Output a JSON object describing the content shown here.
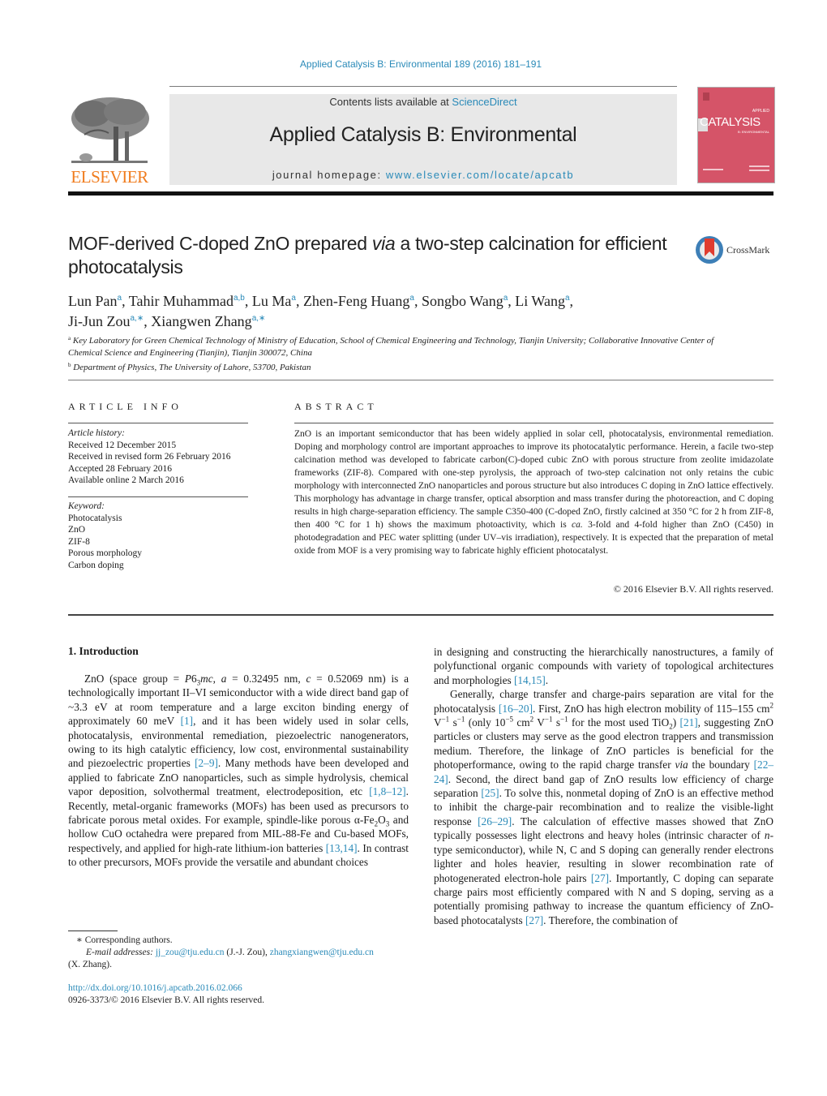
{
  "header": {
    "journal_ref": "Applied Catalysis B: Environmental 189 (2016) 181–191",
    "contents_prefix": "Contents lists available at ",
    "contents_link": "ScienceDirect",
    "journal_title": "Applied Catalysis B: Environmental",
    "homepage_prefix": "journal homepage: ",
    "homepage_link": "www.elsevier.com/locate/apcatb",
    "publisher_logo_text": "ELSEVIER",
    "cover": {
      "title": "CATALYSIS",
      "top_label": "APPLIED",
      "sub_label": "B: ENVIRONMENTAL",
      "color": "#d55468"
    }
  },
  "article": {
    "title_part1": "MOF-derived C-doped ZnO prepared ",
    "title_italic": "via",
    "title_part2": " a two-step calcination for efficient photocatalysis",
    "crossmark_label": "CrossMark",
    "authors": [
      {
        "name": "Lun Pan",
        "aff": "a"
      },
      {
        "name": "Tahir Muhammad",
        "aff": "a,b"
      },
      {
        "name": "Lu Ma",
        "aff": "a"
      },
      {
        "name": "Zhen-Feng Huang",
        "aff": "a"
      },
      {
        "name": "Songbo Wang",
        "aff": "a"
      },
      {
        "name": "Li Wang",
        "aff": "a"
      },
      {
        "name": "Ji-Jun Zou",
        "aff": "a,∗"
      },
      {
        "name": "Xiangwen Zhang",
        "aff": "a,∗"
      }
    ],
    "affiliations": [
      {
        "key": "a",
        "text": "Key Laboratory for Green Chemical Technology of Ministry of Education, School of Chemical Engineering and Technology, Tianjin University; Collaborative Innovative Center of Chemical Science and Engineering (Tianjin), Tianjin 300072, China"
      },
      {
        "key": "b",
        "text": "Department of Physics, The University of Lahore, 53700, Pakistan"
      }
    ]
  },
  "article_info": {
    "heading": "ARTICLE INFO",
    "history_label": "Article history:",
    "history": [
      "Received 12 December 2015",
      "Received in revised form 26 February 2016",
      "Accepted 28 February 2016",
      "Available online 2 March 2016"
    ],
    "keywords_label": "Keyword:",
    "keywords": [
      "Photocatalysis",
      "ZnO",
      "ZIF-8",
      "Porous morphology",
      "Carbon doping"
    ]
  },
  "abstract": {
    "heading": "ABSTRACT",
    "text_part1": "ZnO is an important semiconductor that has been widely applied in solar cell, photocatalysis, environmental remediation. Doping and morphology control are important approaches to improve its photocatalytic performance. Herein, a facile two-step calcination method was developed to fabricate carbon(C)-doped cubic ZnO with porous structure from zeolite imidazolate frameworks (ZIF-8). Compared with one-step pyrolysis, the approach of two-step calcination not only retains the cubic morphology with interconnected ZnO nanoparticles and porous structure but also introduces C doping in ZnO lattice effectively. This morphology has advantage in charge transfer, optical absorption and mass transfer during the photoreaction, and C doping results in high charge-separation efficiency. The sample C350-400 (C-doped ZnO, firstly calcined at 350 °C for 2 h from ZIF-8, then 400 °C for 1 h) shows the maximum photoactivity, which is ",
    "text_italic": "ca.",
    "text_part2": " 3-fold and 4-fold higher than ZnO (C450) in photodegradation and PEC water splitting (under UV–vis irradiation), respectively. It is expected that the preparation of metal oxide from MOF is a very promising way to fabricate highly efficient photocatalyst.",
    "copyright": "© 2016 Elsevier B.V. All rights reserved."
  },
  "introduction": {
    "heading": "1.  Introduction",
    "left_para": [
      {
        "t": "ZnO (space group = "
      },
      {
        "i": "P"
      },
      {
        "t": "6"
      },
      {
        "sub": "3"
      },
      {
        "i": "mc"
      },
      {
        "t": ", "
      },
      {
        "i": "a"
      },
      {
        "t": " = 0.32495 nm, "
      },
      {
        "i": "c"
      },
      {
        "t": " = 0.52069 nm) is a technologically important II–VI semiconductor with a wide direct band gap of ~3.3 eV at room temperature and a large exciton binding energy of approximately 60 meV "
      },
      {
        "c": "[1]"
      },
      {
        "t": ", and it has been widely used in solar cells, photocatalysis, environmental remediation, piezoelectric nanogenerators, owing to its high catalytic efficiency, low cost, environmental sustainability and piezoelectric properties "
      },
      {
        "c": "[2–9]"
      },
      {
        "t": ". Many methods have been developed and applied to fabricate ZnO nanoparticles, such as simple hydrolysis, chemical vapor deposition, solvothermal treatment, electrodeposition, etc "
      },
      {
        "c": "[1,8–12]"
      },
      {
        "t": ". Recently, metal-organic frameworks (MOFs) has been used as precursors to fabricate porous metal oxides. For example, spindle-like porous α-Fe"
      },
      {
        "sub": "2"
      },
      {
        "t": "O"
      },
      {
        "sub": "3"
      },
      {
        "t": " and hollow CuO octahedra were prepared from MIL-88-Fe and Cu-based MOFs, respectively, and applied for high-rate lithium-ion batteries "
      },
      {
        "c": "[13,14]"
      },
      {
        "t": ". In contrast to other precursors, MOFs provide the versatile and abundant choices"
      }
    ],
    "right_para1": [
      {
        "t": "in designing and constructing the hierarchically nanostructures, a family of polyfunctional organic compounds with variety of topological architectures and morphologies "
      },
      {
        "c": "[14,15]"
      },
      {
        "t": "."
      }
    ],
    "right_para2": [
      {
        "t": "Generally, charge transfer and charge-pairs separation are vital for the photocatalysis "
      },
      {
        "c": "[16–20]"
      },
      {
        "t": ". First, ZnO has high electron mobility of 115–155 cm"
      },
      {
        "sup": "2"
      },
      {
        "t": " V"
      },
      {
        "sup": "−1"
      },
      {
        "t": " s"
      },
      {
        "sup": "−1"
      },
      {
        "t": " (only 10"
      },
      {
        "sup": "−5"
      },
      {
        "t": " cm"
      },
      {
        "sup": "2"
      },
      {
        "t": " V"
      },
      {
        "sup": "−1"
      },
      {
        "t": " s"
      },
      {
        "sup": "−1"
      },
      {
        "t": " for the most used TiO"
      },
      {
        "sub": "2"
      },
      {
        "t": ") "
      },
      {
        "c": "[21]"
      },
      {
        "t": ", suggesting ZnO particles or clusters may serve as the good electron trappers and transmission medium. Therefore, the linkage of ZnO particles is beneficial for the photoperformance, owing to the rapid charge transfer "
      },
      {
        "i": "via"
      },
      {
        "t": " the boundary "
      },
      {
        "c": "[22–24]"
      },
      {
        "t": ". Second, the direct band gap of ZnO results low efficiency of charge separation "
      },
      {
        "c": "[25]"
      },
      {
        "t": ". To solve this, nonmetal doping of ZnO is an effective method to inhibit the charge-pair recombination and to realize the visible-light response "
      },
      {
        "c": "[26–29]"
      },
      {
        "t": ". The calculation of effective masses showed that ZnO typically possesses light electrons and heavy holes (intrinsic character of "
      },
      {
        "i": "n"
      },
      {
        "t": "-type semiconductor), while N, C and S doping can generally render electrons lighter and holes heavier, resulting in slower recombination rate of photogenerated electron-hole pairs "
      },
      {
        "c": "[27]"
      },
      {
        "t": ". Importantly, C doping can separate charge pairs most efficiently compared with N and S doping, serving as a potentially promising pathway to increase the quantum efficiency of ZnO-based photocatalysts "
      },
      {
        "c": "[27]"
      },
      {
        "t": ". Therefore, the combination of"
      }
    ]
  },
  "footnotes": {
    "corresponding": "∗  Corresponding authors.",
    "email_label": "E-mail addresses:",
    "email1": "jj_zou@tju.edu.cn",
    "email1_owner": " (J.-J. Zou), ",
    "email2": "zhangxiangwen@tju.edu.cn",
    "email2_owner": "(X. Zhang).",
    "doi": "http://dx.doi.org/10.1016/j.apcatb.2016.02.066",
    "issn_copyright": "0926-3373/© 2016 Elsevier B.V. All rights reserved."
  },
  "colors": {
    "link": "#2a8ab8",
    "elsevier_orange": "#f07c1e",
    "masthead_bg": "#e8e8e8"
  }
}
